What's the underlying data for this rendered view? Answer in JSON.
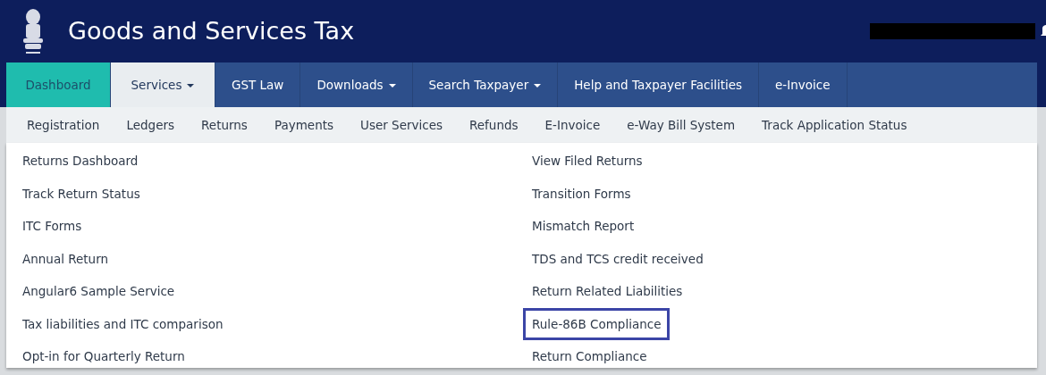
{
  "header": {
    "title": "Goods and Services Tax"
  },
  "nav": [
    {
      "label": "Dashboard",
      "kind": "home",
      "selected": false,
      "caret": false
    },
    {
      "label": "Services",
      "kind": "menu",
      "selected": true,
      "caret": true
    },
    {
      "label": "GST Law",
      "kind": "menu",
      "selected": false,
      "caret": false
    },
    {
      "label": "Downloads",
      "kind": "menu",
      "selected": false,
      "caret": true
    },
    {
      "label": "Search Taxpayer",
      "kind": "menu",
      "selected": false,
      "caret": true
    },
    {
      "label": "Help and Taxpayer Facilities",
      "kind": "menu",
      "selected": false,
      "caret": false
    },
    {
      "label": "e-Invoice",
      "kind": "menu",
      "selected": false,
      "caret": false
    }
  ],
  "submenu": [
    "Registration",
    "Ledgers",
    "Returns",
    "Payments",
    "User Services",
    "Refunds",
    "E-Invoice",
    "e-Way Bill System",
    "Track Application Status"
  ],
  "dropdown": {
    "columns": [
      [
        {
          "label": "Returns Dashboard",
          "highlighted": false
        },
        {
          "label": "Track Return Status",
          "highlighted": false
        },
        {
          "label": "ITC Forms",
          "highlighted": false
        },
        {
          "label": "Annual Return",
          "highlighted": false
        },
        {
          "label": "Angular6 Sample Service",
          "highlighted": false
        },
        {
          "label": "Tax liabilities and ITC comparison",
          "highlighted": false
        },
        {
          "label": "Opt-in for Quarterly Return",
          "highlighted": false
        }
      ],
      [
        {
          "label": "View Filed Returns",
          "highlighted": false
        },
        {
          "label": "Transition Forms",
          "highlighted": false
        },
        {
          "label": "Mismatch Report",
          "highlighted": false
        },
        {
          "label": "TDS and TCS credit received",
          "highlighted": false
        },
        {
          "label": "Return Related Liabilities",
          "highlighted": false
        },
        {
          "label": "Rule-86B Compliance",
          "highlighted": true
        },
        {
          "label": "Return Compliance",
          "highlighted": false
        }
      ]
    ]
  }
}
